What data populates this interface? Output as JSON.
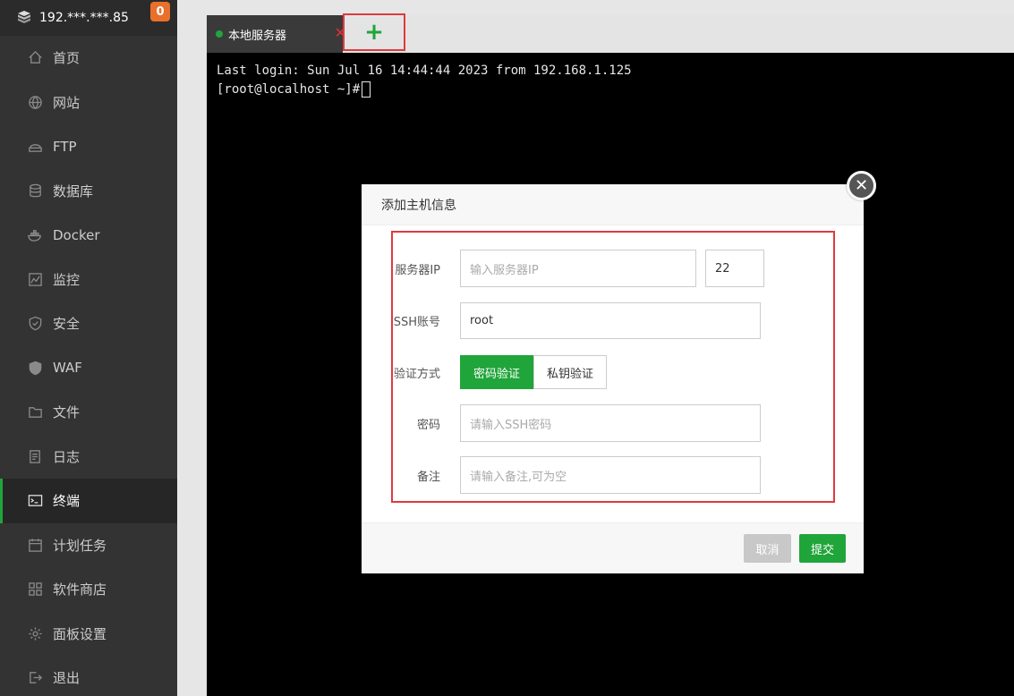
{
  "sidebar": {
    "server_name": "192.***.***.85",
    "badge": "0",
    "items": [
      {
        "label": "首页",
        "icon": "home-icon"
      },
      {
        "label": "网站",
        "icon": "globe-icon"
      },
      {
        "label": "FTP",
        "icon": "ftp-icon"
      },
      {
        "label": "数据库",
        "icon": "database-icon"
      },
      {
        "label": "Docker",
        "icon": "docker-icon"
      },
      {
        "label": "监控",
        "icon": "monitor-icon"
      },
      {
        "label": "安全",
        "icon": "shield-icon"
      },
      {
        "label": "WAF",
        "icon": "waf-shield-icon"
      },
      {
        "label": "文件",
        "icon": "folder-icon"
      },
      {
        "label": "日志",
        "icon": "log-icon"
      },
      {
        "label": "终端",
        "icon": "terminal-icon"
      },
      {
        "label": "计划任务",
        "icon": "calendar-icon"
      },
      {
        "label": "软件商店",
        "icon": "apps-icon"
      },
      {
        "label": "面板设置",
        "icon": "gear-icon"
      },
      {
        "label": "退出",
        "icon": "logout-icon"
      }
    ],
    "active_index": 10
  },
  "terminal": {
    "tab_label": "本地服务器",
    "add_tab": "+",
    "line1": "Last login: Sun Jul 16 14:44:44 2023 from 192.168.1.125",
    "prompt": "[root@localhost ~]#"
  },
  "modal": {
    "title": "添加主机信息",
    "close": "✕",
    "server_ip_label": "服务器IP",
    "server_ip_placeholder": "输入服务器IP",
    "port_value": "22",
    "ssh_account_label": "SSH账号",
    "ssh_account_value": "root",
    "auth_label": "验证方式",
    "auth_password": "密码验证",
    "auth_key": "私钥验证",
    "password_label": "密码",
    "password_placeholder": "请输入SSH密码",
    "note_label": "备注",
    "note_placeholder": "请输入备注,可为空",
    "cancel": "取消",
    "submit": "提交"
  },
  "colors": {
    "accent": "#20a53a",
    "highlight": "#e0393e",
    "sidebar_bg": "#333333"
  }
}
